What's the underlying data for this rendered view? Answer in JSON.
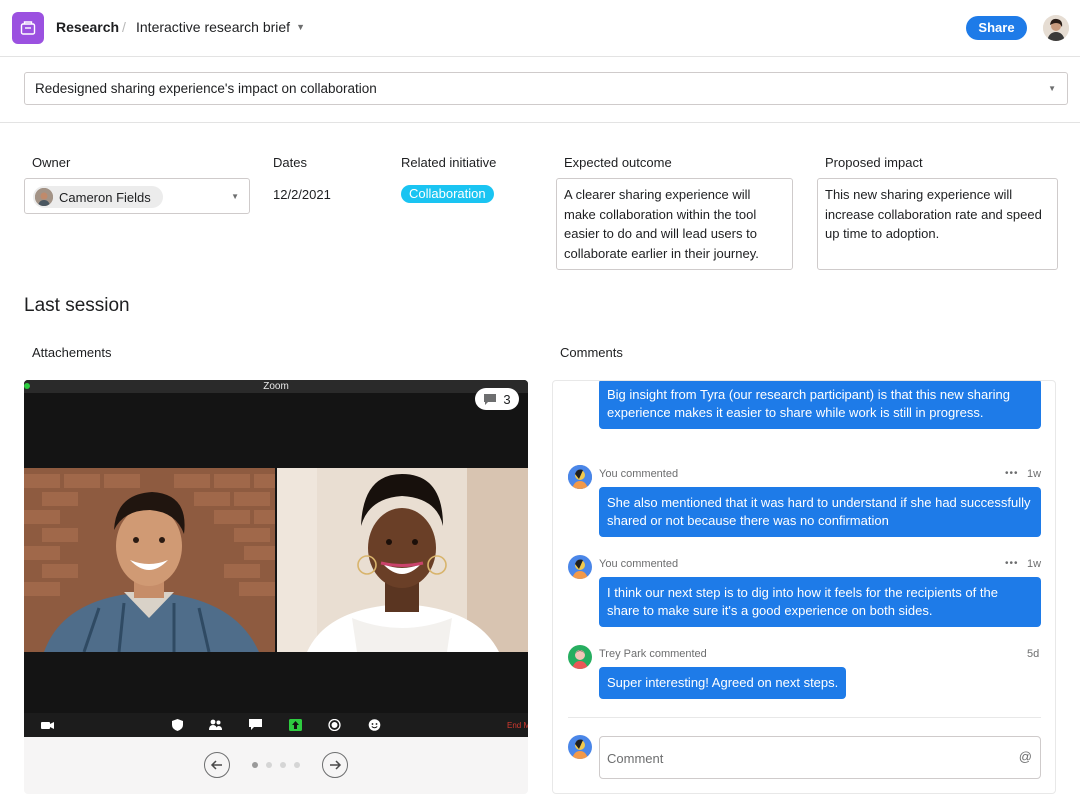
{
  "header": {
    "breadcrumb_root": "Research",
    "separator": "/",
    "page_title": "Interactive research brief",
    "share_label": "Share",
    "accent": "#9b51e0",
    "share_color": "#1e7be8"
  },
  "brief": {
    "title": "Redesigned sharing experience's impact on collaboration"
  },
  "fields": {
    "owner_label": "Owner",
    "owner_name": "Cameron Fields",
    "dates_label": "Dates",
    "dates_value": "12/2/2021",
    "initiative_label": "Related initiative",
    "initiative_value": "Collaboration",
    "initiative_color": "#1ac4f2",
    "expected_label": "Expected outcome",
    "expected_value": "A clearer sharing experience will make collaboration within the tool easier to do and will lead users to collaborate earlier in their journey.",
    "impact_label": "Proposed impact",
    "impact_value": "This new sharing experience will increase collaboration rate and speed up time to adoption."
  },
  "session": {
    "title": "Last session",
    "attachments_label": "Attachements",
    "comments_label": "Comments",
    "zoom_title": "Zoom",
    "comment_count": "3",
    "end_label": "End M",
    "pages": 4,
    "current_page": 1
  },
  "comments": [
    {
      "author": "",
      "time": "",
      "text": "Big insight from Tyra (our research participant) is that this new sharing experience makes it easier to share while work is still in progress."
    },
    {
      "author": "You commented",
      "time": "1w",
      "text": "She also mentioned that it was hard to understand if she had successfully shared or not because there was no confirmation"
    },
    {
      "author": "You commented",
      "time": "1w",
      "text": "I think our next step is to dig into how it feels for the recipients of the share to make sure it's a good experience on both sides."
    },
    {
      "author": "Trey Park commented",
      "time": "5d",
      "text": "Super interesting! Agreed on next steps."
    }
  ],
  "composer": {
    "placeholder": "Comment",
    "mention_symbol": "@"
  }
}
